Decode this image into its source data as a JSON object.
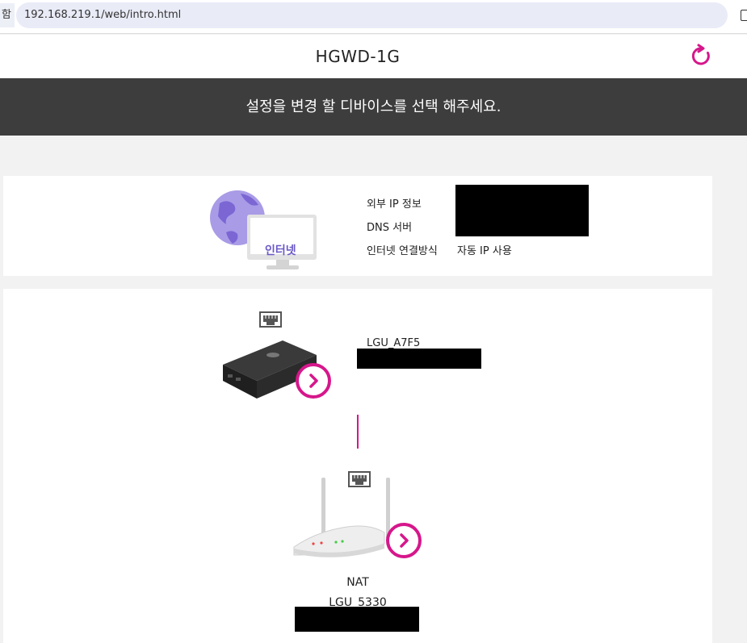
{
  "browser": {
    "address_prefix": "함",
    "url": "192.168.219.1/web/intro.html"
  },
  "header": {
    "title": "HGWD-1G",
    "refresh_icon": "refresh-icon",
    "accent_color": "#d6178b"
  },
  "banner": {
    "text": "설정을 변경 할 디바이스를 선택 해주세요."
  },
  "internet": {
    "icon_label": "인터넷",
    "external_ip_label": "외부 IP 정보",
    "dns_label": "DNS 서버",
    "connection_label": "인터넷 연결방식",
    "connection_value": "자동 IP 사용"
  },
  "devices": {
    "modem": {
      "name": "LGU_A7F5",
      "lan_icon": "ethernet-port-icon",
      "arrow_icon": "chevron-right-icon"
    },
    "router": {
      "mode": "NAT",
      "name": "LGU_5330",
      "lan_icon": "ethernet-port-icon",
      "arrow_icon": "chevron-right-icon"
    }
  }
}
